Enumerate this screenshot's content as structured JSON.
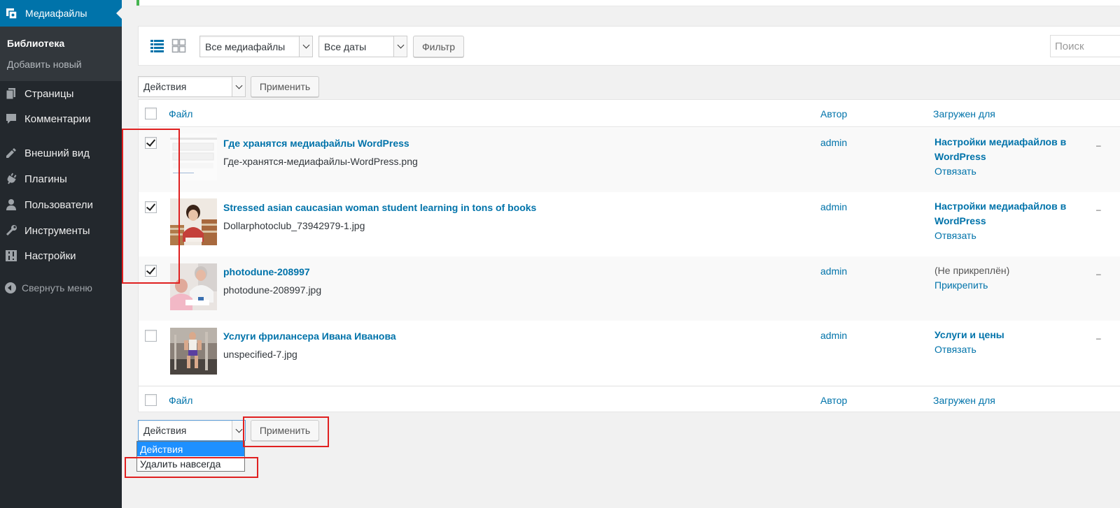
{
  "sidebar": {
    "current_menu": "Медиафайлы",
    "submenu": {
      "library": "Библиотека",
      "add_new": "Добавить новый"
    },
    "items": [
      {
        "label": "Страницы",
        "icon": "pages-icon"
      },
      {
        "label": "Комментарии",
        "icon": "comments-icon"
      },
      {
        "label": "Внешний вид",
        "icon": "appearance-icon"
      },
      {
        "label": "Плагины",
        "icon": "plugins-icon"
      },
      {
        "label": "Пользователи",
        "icon": "users-icon"
      },
      {
        "label": "Инструменты",
        "icon": "tools-icon"
      },
      {
        "label": "Настройки",
        "icon": "settings-icon"
      }
    ],
    "collapse": "Свернуть меню"
  },
  "filters": {
    "media_type": "Все медиафайлы",
    "dates": "Все даты",
    "filter_button": "Фильтр",
    "search_placeholder": "Поиск"
  },
  "bulk_top": {
    "action": "Действия",
    "apply": "Применить"
  },
  "table": {
    "headers": {
      "file": "Файл",
      "author": "Автор",
      "uploaded_to": "Загружен для"
    },
    "rows": [
      {
        "checked": true,
        "title": "Где хранятся медиафайлы WordPress",
        "filename": "Где-хранятся-медиафайлы-WordPress.png",
        "author": "admin",
        "attached_to": "Настройки медиафайлов в WordPress",
        "attach_action": "Отвязать"
      },
      {
        "checked": true,
        "title": "Stressed asian caucasian woman student learning in tons of books",
        "filename": "Dollarphotoclub_73942979-1.jpg",
        "author": "admin",
        "attached_to": "Настройки медиафайлов в WordPress",
        "attach_action": "Отвязать"
      },
      {
        "checked": true,
        "title": "photodune-208997",
        "filename": "photodune-208997.jpg",
        "author": "admin",
        "attached_to": "(Не прикреплён)",
        "attach_action": "Прикрепить"
      },
      {
        "checked": false,
        "title": "Услуги фрилансера Ивана Иванова",
        "filename": "unspecified-7.jpg",
        "author": "admin",
        "attached_to": "Услуги и цены",
        "attach_action": "Отвязать"
      }
    ]
  },
  "bulk_bottom": {
    "action": "Действия",
    "apply": "Применить",
    "options": [
      "Действия",
      "Удалить навсегда"
    ]
  },
  "colors": {
    "sidebar_bg": "#23282d",
    "accent": "#0073aa",
    "highlight": "#e02020"
  }
}
